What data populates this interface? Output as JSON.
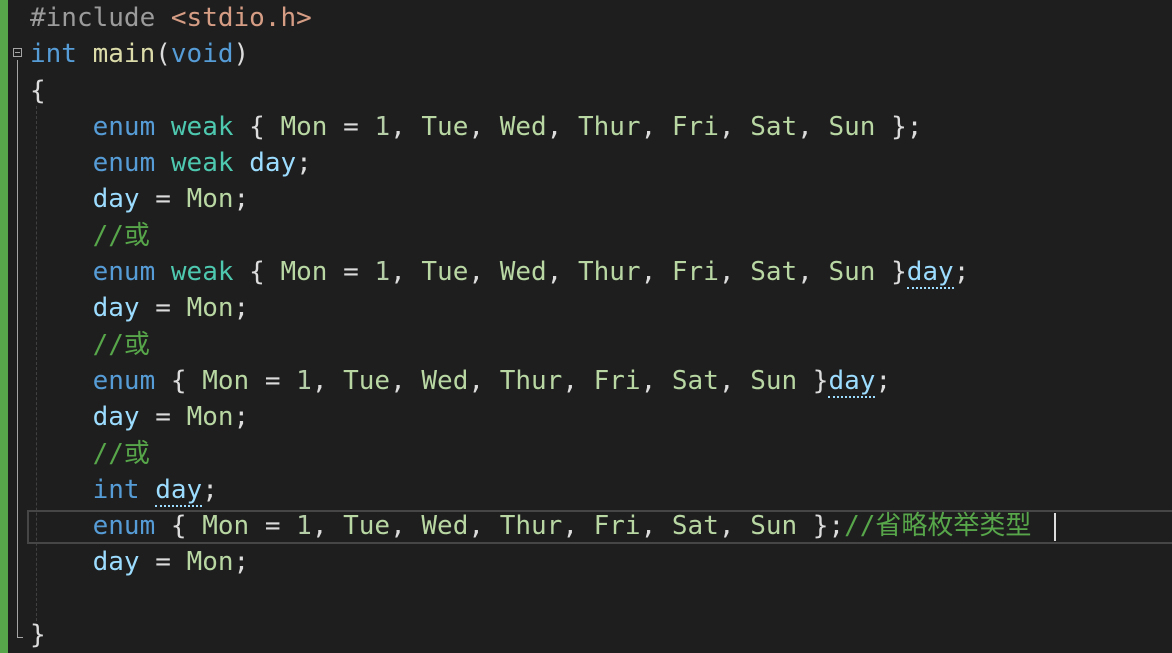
{
  "editor": {
    "language": "C",
    "lines": [
      [
        {
          "t": "#include ",
          "c": "pre"
        },
        {
          "t": "<stdio.h>",
          "c": "str"
        }
      ],
      [
        {
          "t": "int",
          "c": "kw"
        },
        {
          "t": " ",
          "c": "pun"
        },
        {
          "t": "main",
          "c": "fn"
        },
        {
          "t": "(",
          "c": "pun"
        },
        {
          "t": "void",
          "c": "kw"
        },
        {
          "t": ")",
          "c": "pun"
        }
      ],
      [
        {
          "t": "{",
          "c": "pun"
        }
      ],
      [
        {
          "t": "    ",
          "c": "pun"
        },
        {
          "t": "enum",
          "c": "kw"
        },
        {
          "t": " ",
          "c": "pun"
        },
        {
          "t": "weak",
          "c": "typ"
        },
        {
          "t": " { ",
          "c": "pun"
        },
        {
          "t": "Mon",
          "c": "enm"
        },
        {
          "t": " = ",
          "c": "pun"
        },
        {
          "t": "1",
          "c": "num"
        },
        {
          "t": ", ",
          "c": "pun"
        },
        {
          "t": "Tue",
          "c": "enm"
        },
        {
          "t": ", ",
          "c": "pun"
        },
        {
          "t": "Wed",
          "c": "enm"
        },
        {
          "t": ", ",
          "c": "pun"
        },
        {
          "t": "Thur",
          "c": "enm"
        },
        {
          "t": ", ",
          "c": "pun"
        },
        {
          "t": "Fri",
          "c": "enm"
        },
        {
          "t": ", ",
          "c": "pun"
        },
        {
          "t": "Sat",
          "c": "enm"
        },
        {
          "t": ", ",
          "c": "pun"
        },
        {
          "t": "Sun",
          "c": "enm"
        },
        {
          "t": " };",
          "c": "pun"
        }
      ],
      [
        {
          "t": "    ",
          "c": "pun"
        },
        {
          "t": "enum",
          "c": "kw"
        },
        {
          "t": " ",
          "c": "pun"
        },
        {
          "t": "weak",
          "c": "typ"
        },
        {
          "t": " ",
          "c": "pun"
        },
        {
          "t": "day",
          "c": "var"
        },
        {
          "t": ";",
          "c": "pun"
        }
      ],
      [
        {
          "t": "    ",
          "c": "pun"
        },
        {
          "t": "day",
          "c": "var"
        },
        {
          "t": " = ",
          "c": "pun"
        },
        {
          "t": "Mon",
          "c": "enm"
        },
        {
          "t": ";",
          "c": "pun"
        }
      ],
      [
        {
          "t": "    ",
          "c": "pun"
        },
        {
          "t": "//或",
          "c": "cmt"
        }
      ],
      [
        {
          "t": "    ",
          "c": "pun"
        },
        {
          "t": "enum",
          "c": "kw"
        },
        {
          "t": " ",
          "c": "pun"
        },
        {
          "t": "weak",
          "c": "typ"
        },
        {
          "t": " { ",
          "c": "pun"
        },
        {
          "t": "Mon",
          "c": "enm"
        },
        {
          "t": " = ",
          "c": "pun"
        },
        {
          "t": "1",
          "c": "num"
        },
        {
          "t": ", ",
          "c": "pun"
        },
        {
          "t": "Tue",
          "c": "enm"
        },
        {
          "t": ", ",
          "c": "pun"
        },
        {
          "t": "Wed",
          "c": "enm"
        },
        {
          "t": ", ",
          "c": "pun"
        },
        {
          "t": "Thur",
          "c": "enm"
        },
        {
          "t": ", ",
          "c": "pun"
        },
        {
          "t": "Fri",
          "c": "enm"
        },
        {
          "t": ", ",
          "c": "pun"
        },
        {
          "t": "Sat",
          "c": "enm"
        },
        {
          "t": ", ",
          "c": "pun"
        },
        {
          "t": "Sun",
          "c": "enm"
        },
        {
          "t": " }",
          "c": "pun"
        },
        {
          "t": "day",
          "c": "var sq"
        },
        {
          "t": ";",
          "c": "pun"
        }
      ],
      [
        {
          "t": "    ",
          "c": "pun"
        },
        {
          "t": "day",
          "c": "var"
        },
        {
          "t": " = ",
          "c": "pun"
        },
        {
          "t": "Mon",
          "c": "enm"
        },
        {
          "t": ";",
          "c": "pun"
        }
      ],
      [
        {
          "t": "    ",
          "c": "pun"
        },
        {
          "t": "//或",
          "c": "cmt"
        }
      ],
      [
        {
          "t": "    ",
          "c": "pun"
        },
        {
          "t": "enum",
          "c": "kw"
        },
        {
          "t": " { ",
          "c": "pun"
        },
        {
          "t": "Mon",
          "c": "enm"
        },
        {
          "t": " = ",
          "c": "pun"
        },
        {
          "t": "1",
          "c": "num"
        },
        {
          "t": ", ",
          "c": "pun"
        },
        {
          "t": "Tue",
          "c": "enm"
        },
        {
          "t": ", ",
          "c": "pun"
        },
        {
          "t": "Wed",
          "c": "enm"
        },
        {
          "t": ", ",
          "c": "pun"
        },
        {
          "t": "Thur",
          "c": "enm"
        },
        {
          "t": ", ",
          "c": "pun"
        },
        {
          "t": "Fri",
          "c": "enm"
        },
        {
          "t": ", ",
          "c": "pun"
        },
        {
          "t": "Sat",
          "c": "enm"
        },
        {
          "t": ", ",
          "c": "pun"
        },
        {
          "t": "Sun",
          "c": "enm"
        },
        {
          "t": " }",
          "c": "pun"
        },
        {
          "t": "day",
          "c": "var sq"
        },
        {
          "t": ";",
          "c": "pun"
        }
      ],
      [
        {
          "t": "    ",
          "c": "pun"
        },
        {
          "t": "day",
          "c": "var"
        },
        {
          "t": " = ",
          "c": "pun"
        },
        {
          "t": "Mon",
          "c": "enm"
        },
        {
          "t": ";",
          "c": "pun"
        }
      ],
      [
        {
          "t": "    ",
          "c": "pun"
        },
        {
          "t": "//或",
          "c": "cmt"
        }
      ],
      [
        {
          "t": "    ",
          "c": "pun"
        },
        {
          "t": "int",
          "c": "kw"
        },
        {
          "t": " ",
          "c": "pun"
        },
        {
          "t": "day",
          "c": "var sq"
        },
        {
          "t": ";",
          "c": "pun"
        }
      ],
      [
        {
          "t": "    ",
          "c": "pun"
        },
        {
          "t": "enum",
          "c": "kw"
        },
        {
          "t": " { ",
          "c": "pun"
        },
        {
          "t": "Mon",
          "c": "enm"
        },
        {
          "t": " = ",
          "c": "pun"
        },
        {
          "t": "1",
          "c": "num"
        },
        {
          "t": ", ",
          "c": "pun"
        },
        {
          "t": "Tue",
          "c": "enm"
        },
        {
          "t": ", ",
          "c": "pun"
        },
        {
          "t": "Wed",
          "c": "enm"
        },
        {
          "t": ", ",
          "c": "pun"
        },
        {
          "t": "Thur",
          "c": "enm"
        },
        {
          "t": ", ",
          "c": "pun"
        },
        {
          "t": "Fri",
          "c": "enm"
        },
        {
          "t": ", ",
          "c": "pun"
        },
        {
          "t": "Sat",
          "c": "enm"
        },
        {
          "t": ", ",
          "c": "pun"
        },
        {
          "t": "Sun",
          "c": "enm"
        },
        {
          "t": " };",
          "c": "pun"
        },
        {
          "t": "//省略枚举类型",
          "c": "cmt"
        }
      ],
      [
        {
          "t": "    ",
          "c": "pun"
        },
        {
          "t": "day",
          "c": "var"
        },
        {
          "t": " = ",
          "c": "pun"
        },
        {
          "t": "Mon",
          "c": "enm"
        },
        {
          "t": ";",
          "c": "pun"
        }
      ],
      [],
      [
        {
          "t": "}",
          "c": "pun"
        }
      ]
    ],
    "colors": {
      "background": "#1e1e1e",
      "keyword": "#569cd6",
      "type": "#4ec9b0",
      "function": "#dcdcaa",
      "variable": "#9cdcfe",
      "enum_member": "#b8d7a3",
      "number": "#b5cea8",
      "string": "#d69d85",
      "preprocessor": "#9b9b9b",
      "comment": "#57a64a",
      "plain": "#dcdcdc",
      "change_bar": "#57a64a"
    },
    "icons": {
      "fold_marker": "collapse-minus-icon"
    }
  }
}
